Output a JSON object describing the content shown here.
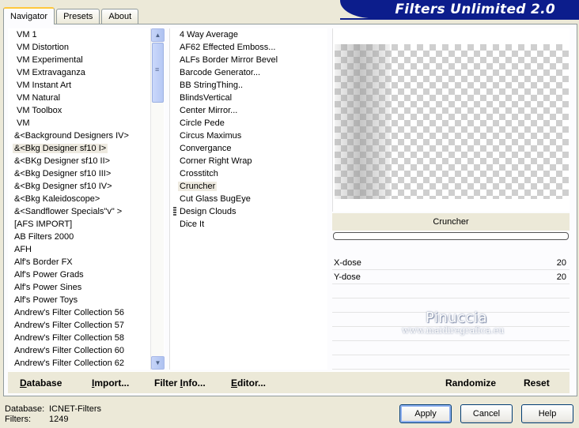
{
  "tabs": [
    {
      "label": "Navigator",
      "active": true
    },
    {
      "label": "Presets",
      "active": false
    },
    {
      "label": "About",
      "active": false
    }
  ],
  "banner_title": "Filters Unlimited 2.0",
  "categories": [
    "VM 1",
    "VM Distortion",
    "VM Experimental",
    "VM Extravaganza",
    "VM Instant Art",
    "VM Natural",
    "VM Toolbox",
    "VM",
    "&<Background Designers IV>",
    "&<Bkg Designer sf10 I>",
    "&<BKg Designer sf10 II>",
    "&<Bkg Designer sf10 III>",
    "&<Bkg Designer sf10 IV>",
    "&<Bkg Kaleidoscope>",
    "&<Sandflower Specials\"v\" >",
    "[AFS IMPORT]",
    "AB Filters 2000",
    "AFH",
    "Alf's Border FX",
    "Alf's Power Grads",
    "Alf's Power Sines",
    "Alf's Power Toys",
    "Andrew's Filter Collection 56",
    "Andrew's Filter Collection 57",
    "Andrew's Filter Collection 58",
    "Andrew's Filter Collection 60",
    "Andrew's Filter Collection 62"
  ],
  "selected_category_index": 9,
  "scrollbar": {
    "up_icon": "▲",
    "down_icon": "▼",
    "thumb_grip": "≡"
  },
  "filters": [
    "4 Way Average",
    "AF62 Effected Emboss...",
    "ALFs Border Mirror Bevel",
    "Barcode Generator...",
    "BB StringThing..",
    "BlindsVertical",
    "Center Mirror...",
    "Circle Pede",
    "Circus Maximus",
    "Convergance",
    "Corner Right Wrap",
    "Crosstitch",
    "Cruncher",
    "Cut Glass  BugEye",
    "Design Clouds",
    "Dice It"
  ],
  "selected_filter_index": 12,
  "preview_filter_name": "Cruncher",
  "params": [
    {
      "label": "X-dose",
      "value": "20"
    },
    {
      "label": "Y-dose",
      "value": "20"
    }
  ],
  "watermark": {
    "name": "Pinuccia",
    "url": "www.maidiregrafica.eu"
  },
  "toolbar": {
    "database": "Database",
    "import": "Import...",
    "filter_info": "Filter Info...",
    "editor": "Editor...",
    "randomize": "Randomize",
    "reset": "Reset"
  },
  "status": {
    "database_label": "Database:",
    "database_value": "ICNET-Filters",
    "filters_label": "Filters:",
    "filters_value": "1249"
  },
  "buttons": {
    "apply": "Apply",
    "cancel": "Cancel",
    "help": "Help"
  },
  "colors": {
    "banner": "#0c1d8c",
    "window_bg": "#ece9d8",
    "selection": "#eeeae0"
  }
}
